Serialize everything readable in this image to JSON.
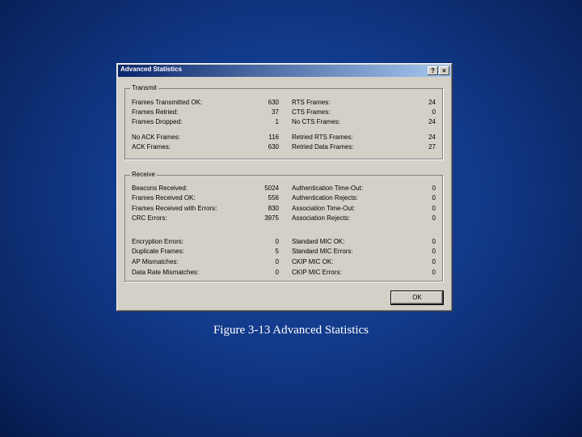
{
  "window": {
    "title": "Advanced Statistics",
    "help_label": "?",
    "close_label": "×"
  },
  "transmit": {
    "title": "Transmit",
    "left": [
      {
        "label": "Frames Transmitted OK:",
        "value": "630"
      },
      {
        "label": "Frames Retried:",
        "value": "37"
      },
      {
        "label": "Frames Dropped:",
        "value": "1"
      },
      {
        "label": "No ACK Frames:",
        "value": "116"
      },
      {
        "label": "ACK Frames:",
        "value": "630"
      }
    ],
    "right": [
      {
        "label": "RTS Frames:",
        "value": "24"
      },
      {
        "label": "CTS Frames:",
        "value": "0"
      },
      {
        "label": "No CTS Frames:",
        "value": "24"
      },
      {
        "label": "Retried RTS Frames:",
        "value": "24"
      },
      {
        "label": "Retried Data Frames:",
        "value": "27"
      }
    ]
  },
  "receive": {
    "title": "Receive",
    "left": [
      {
        "label": "Beacons Received:",
        "value": "5024"
      },
      {
        "label": "Frames Received OK:",
        "value": "556"
      },
      {
        "label": "Frames Received with Errors:",
        "value": "830"
      },
      {
        "label": "CRC Errors:",
        "value": "3975"
      },
      {
        "label": "Encryption Errors:",
        "value": "0"
      },
      {
        "label": "Duplicate Frames:",
        "value": "5"
      },
      {
        "label": "AP Mismatches:",
        "value": "0"
      },
      {
        "label": "Data Rate Mismatches:",
        "value": "0"
      }
    ],
    "right": [
      {
        "label": "Authentication Time-Out:",
        "value": "0"
      },
      {
        "label": "Authentication Rejects:",
        "value": "0"
      },
      {
        "label": "Association Time-Out:",
        "value": "0"
      },
      {
        "label": "Association Rejects:",
        "value": "0"
      },
      {
        "label": "Standard MIC OK:",
        "value": "0"
      },
      {
        "label": "Standard MIC Errors:",
        "value": "0"
      },
      {
        "label": "CKIP MIC OK:",
        "value": "0"
      },
      {
        "label": "CKIP MIC Errors:",
        "value": "0"
      }
    ]
  },
  "ok_label": "OK",
  "caption": "Figure 3-13 Advanced Statistics"
}
